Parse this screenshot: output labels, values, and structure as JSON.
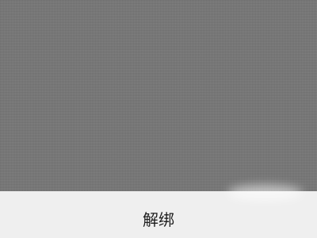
{
  "action_sheet": {
    "unbind_label": "解绑"
  },
  "colors": {
    "overlay": "#7a7a7a",
    "sheet_background": "#efefef",
    "button_text": "#1c1c1c"
  }
}
